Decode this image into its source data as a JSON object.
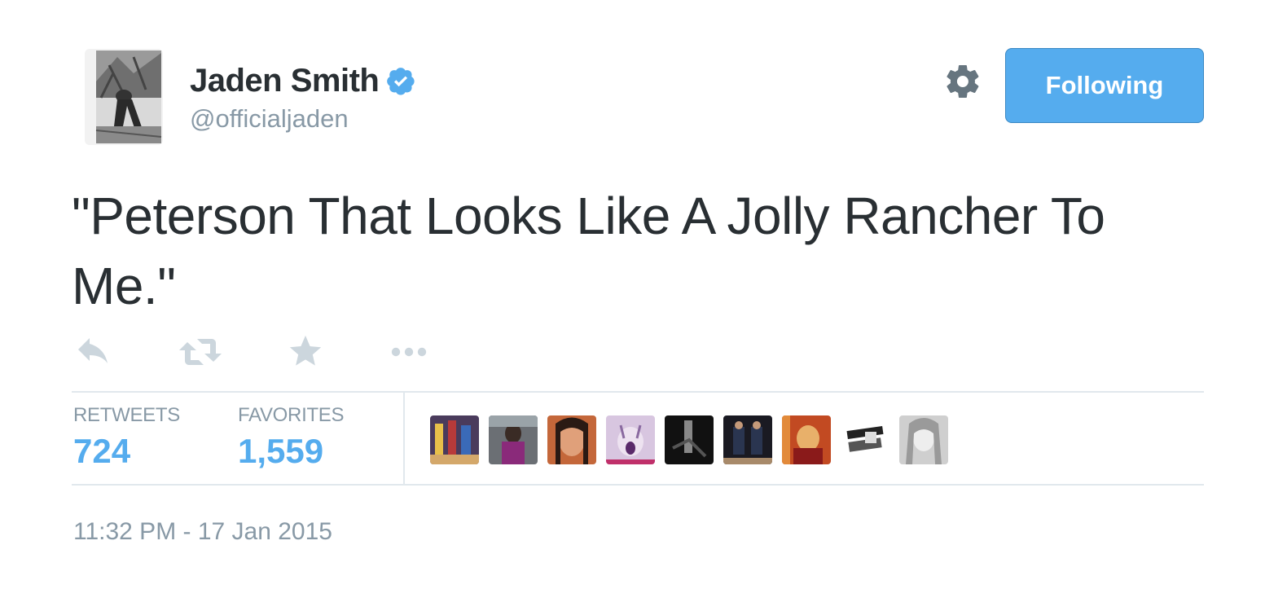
{
  "user": {
    "fullname": "Jaden Smith",
    "handle": "@officialjaden"
  },
  "header": {
    "follow_label": "Following"
  },
  "tweet": {
    "text": "\"Peterson That Looks Like A Jolly Rancher To Me.\""
  },
  "stats": {
    "retweets_label": "RETWEETS",
    "retweets_count": "724",
    "favorites_label": "FAVORITES",
    "favorites_count": "1,559"
  },
  "timestamp": "11:32 PM - 17 Jan 2015",
  "colors": {
    "accent": "#55acee",
    "muted": "#8899a6",
    "text": "#292f33",
    "divider": "#e1e8ed",
    "icon": "#ccd6dd",
    "gear": "#66757f"
  },
  "icons": {
    "verified": "verified-badge-icon",
    "gear": "gear-icon",
    "reply": "reply-icon",
    "retweet": "retweet-icon",
    "favorite": "star-icon",
    "more": "more-icon"
  }
}
